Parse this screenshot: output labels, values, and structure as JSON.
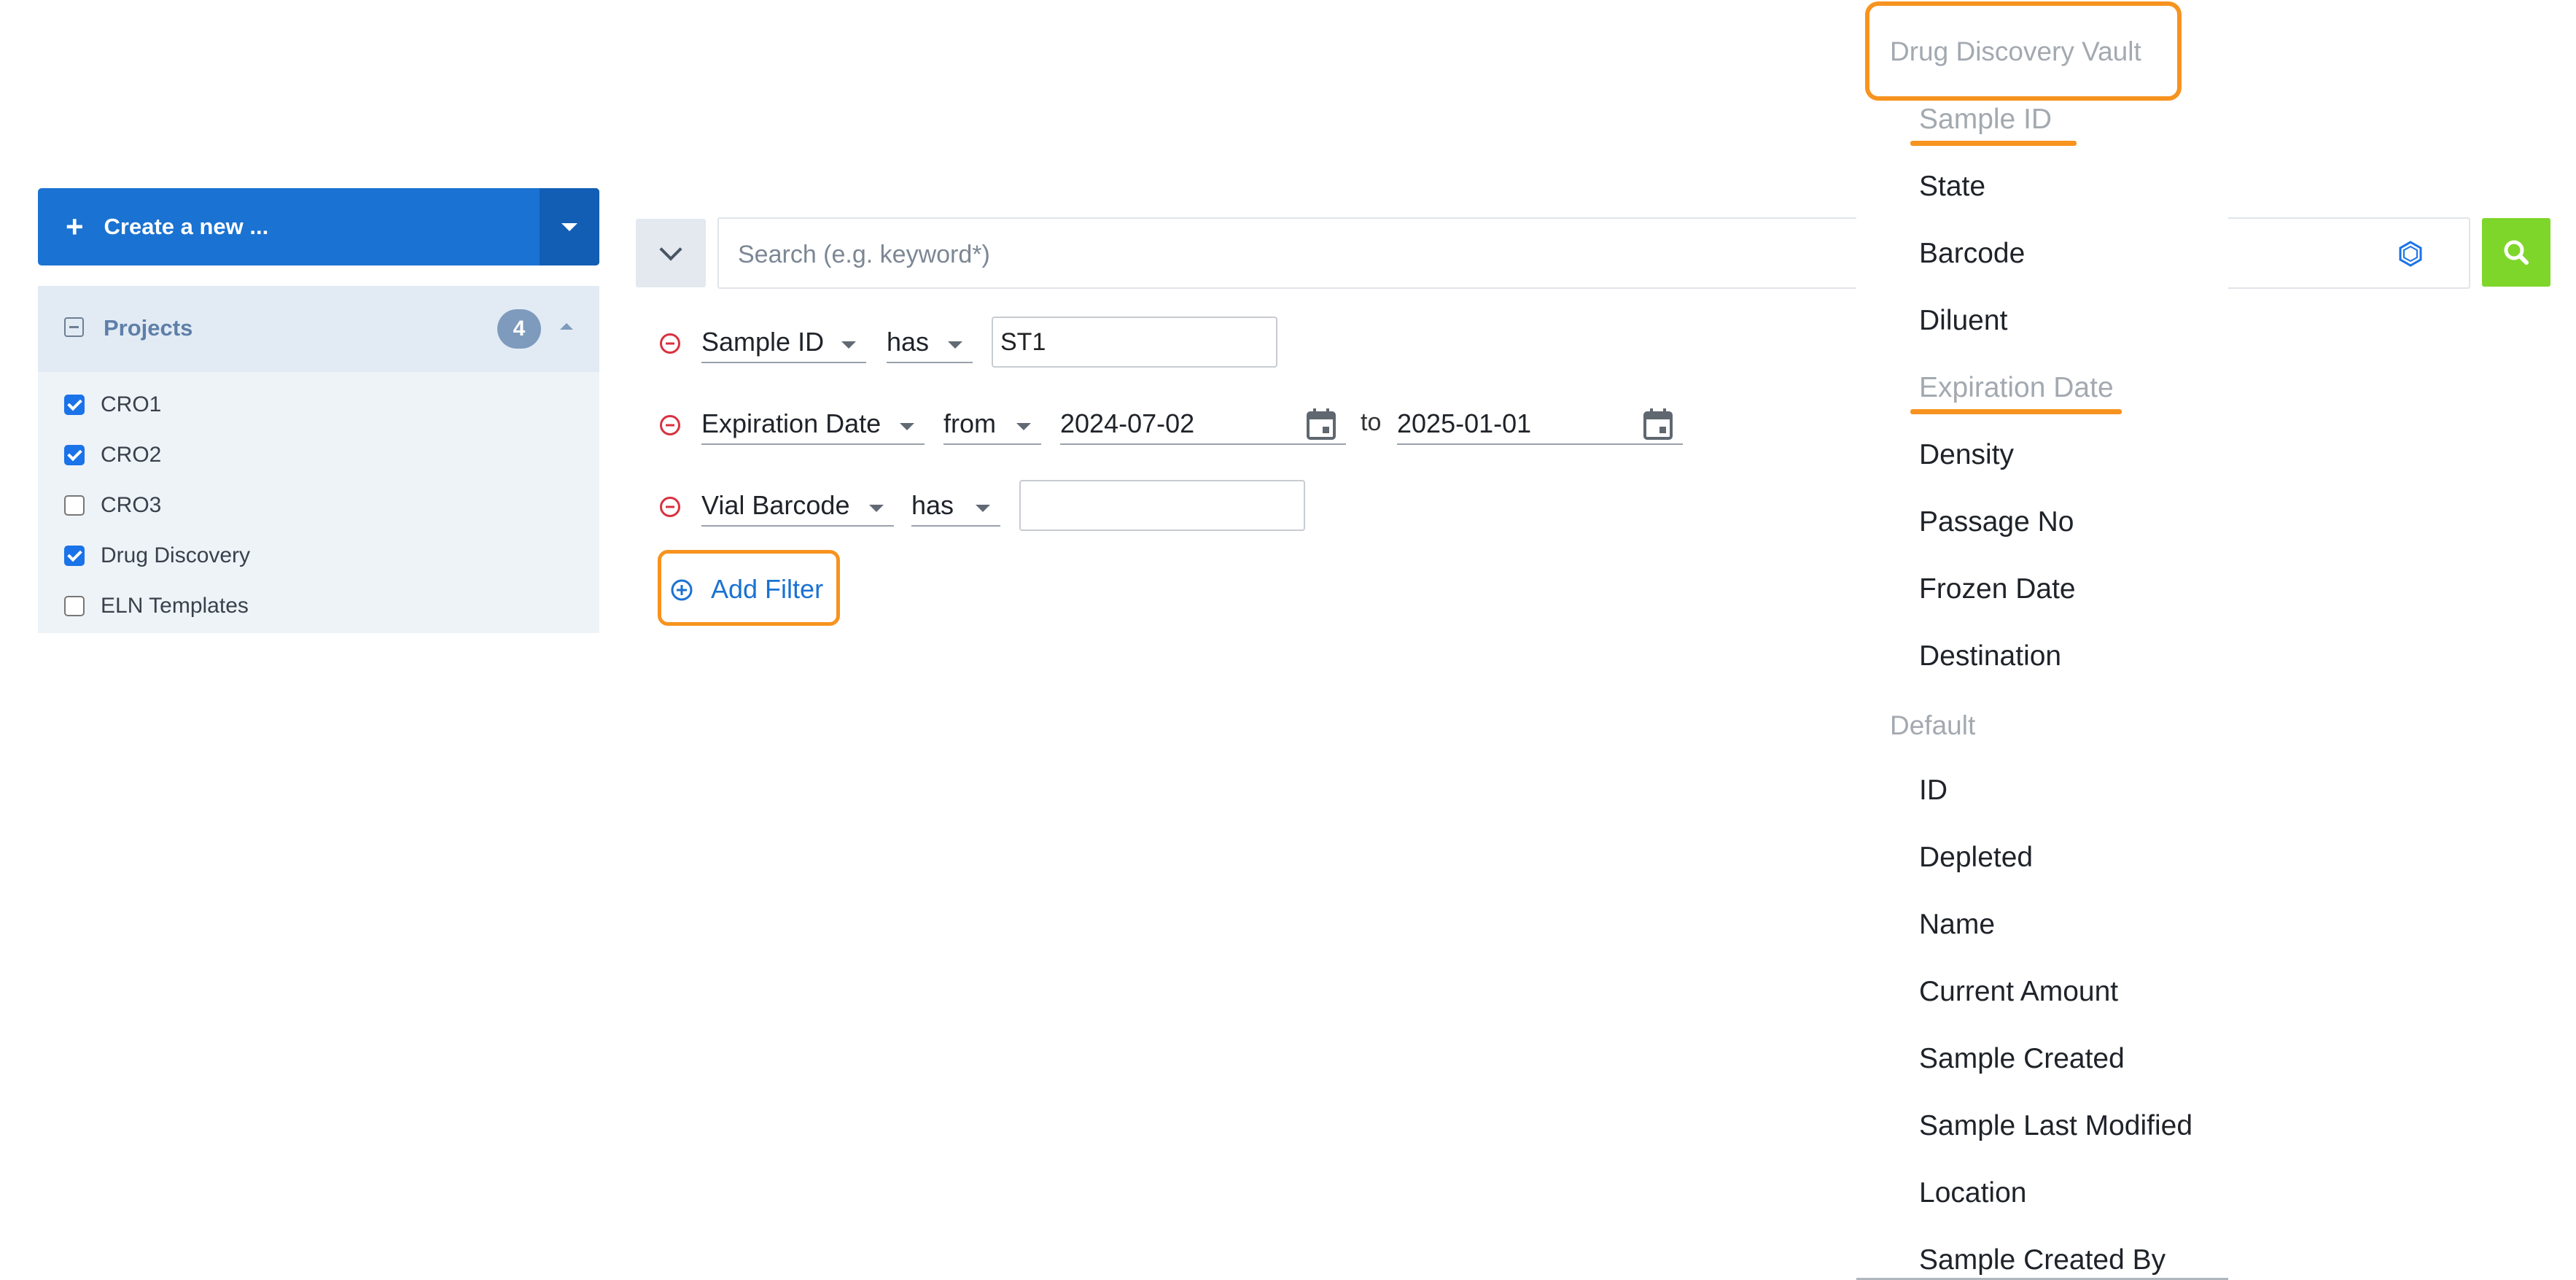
{
  "create_button": {
    "label": "Create a new ...",
    "plus": "+"
  },
  "projects": {
    "title": "Projects",
    "count": "4",
    "items": [
      {
        "label": "CRO1",
        "checked": true
      },
      {
        "label": "CRO2",
        "checked": true
      },
      {
        "label": "CRO3",
        "checked": false
      },
      {
        "label": "Drug Discovery",
        "checked": true
      },
      {
        "label": "ELN Templates",
        "checked": false
      }
    ]
  },
  "search": {
    "placeholder": "Search (e.g. keyword*)",
    "value": ""
  },
  "filters": [
    {
      "field": "Sample ID",
      "operator": "has",
      "value": "ST1"
    },
    {
      "field": "Expiration Date",
      "operator": "from",
      "from": "2024-07-02",
      "to_label": "to",
      "to": "2025-01-01"
    },
    {
      "field": "Vial Barcode",
      "operator": "has",
      "value": ""
    }
  ],
  "add_filter": {
    "label": "Add Filter"
  },
  "dropdown": {
    "groups": [
      {
        "title": "Drug Discovery Vault",
        "items": [
          "Sample ID",
          "State",
          "Barcode",
          "Diluent",
          "Expiration Date",
          "Density",
          "Passage No",
          "Frozen Date",
          "Destination"
        ]
      },
      {
        "title": "Default",
        "items": [
          "ID",
          "Depleted",
          "Name",
          "Current Amount",
          "Sample Created",
          "Sample Last Modified",
          "Location",
          "Sample Created By"
        ]
      }
    ],
    "disabled_items": [
      "Sample ID",
      "Expiration Date"
    ]
  },
  "colors": {
    "primary": "#1a72d2",
    "search_go": "#7fd62b",
    "highlight": "#f7931e",
    "remove_icon": "#d9313f"
  }
}
